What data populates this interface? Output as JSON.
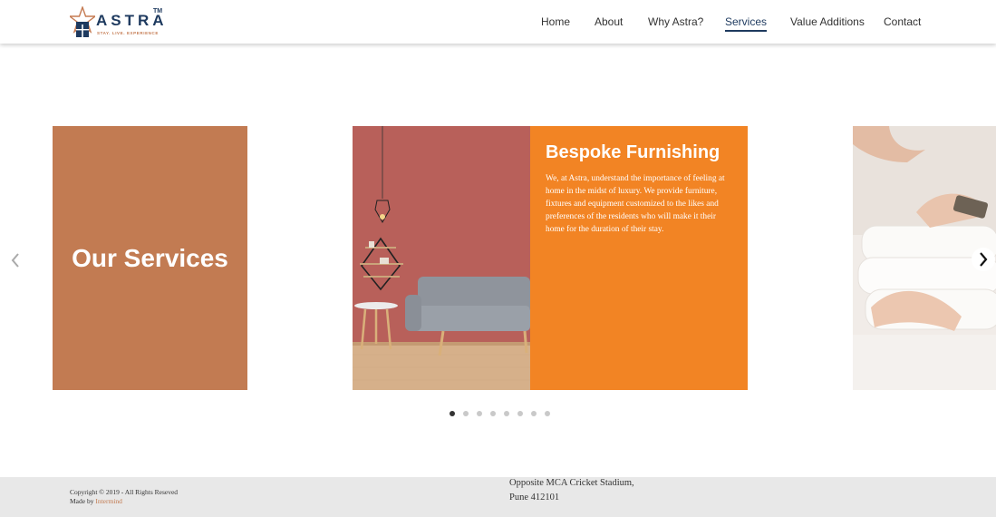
{
  "header": {
    "logo": {
      "name": "ASTRA",
      "trademark": "TM",
      "tagline": "STAY. LIVE. EXPERIENCE"
    },
    "nav": [
      {
        "label": "Home",
        "active": false
      },
      {
        "label": "About",
        "active": false
      },
      {
        "label": "Why Astra?",
        "active": false
      },
      {
        "label": "Services",
        "active": true
      },
      {
        "label": "Value Additions",
        "active": false
      },
      {
        "label": "Contact",
        "active": false
      }
    ]
  },
  "carousel": {
    "heading": "Our Services",
    "slide": {
      "title": "Bespoke Furnishing",
      "body": "We, at Astra, understand the importance of feeling at home in the midst of luxury. We provide furniture, fixtures and equipment customized to the likes and preferences of the residents who will make it their home for the duration of their stay."
    },
    "prev_icon": "chevron-left-icon",
    "next_icon": "chevron-right-icon",
    "dots_count": 8,
    "active_dot": 0
  },
  "footer": {
    "copyright": "Copyright © 2019 - All Rights Reseved",
    "made_by_prefix": "Made by",
    "made_by_link": "Intermind",
    "address_line1": "Opposite MCA Cricket Stadium,",
    "address_line2": "Pune 412101"
  },
  "colors": {
    "brand_navy": "#1e3a5f",
    "services_brown": "#c27b52",
    "slide_orange": "#f28424",
    "footer_bg": "#e8e8e8"
  }
}
